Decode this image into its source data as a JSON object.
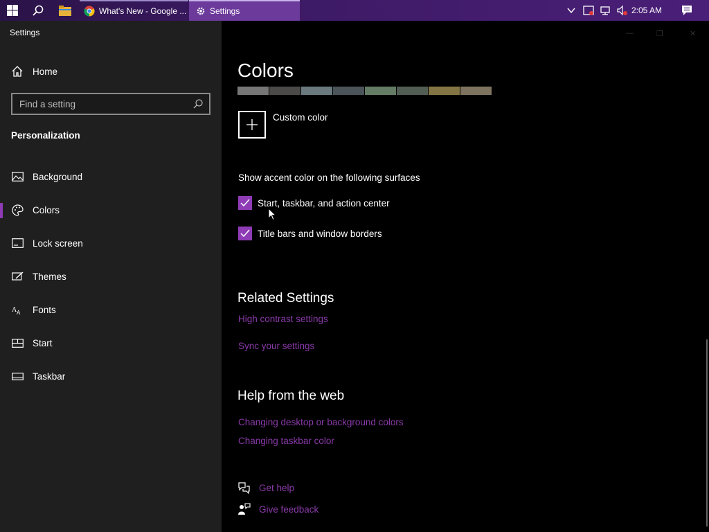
{
  "taskbar": {
    "apps": [
      {
        "label": "What's New - Google ..."
      },
      {
        "label": "Settings"
      }
    ],
    "clock": "2:05 AM"
  },
  "sidebar": {
    "app_title": "Settings",
    "home": "Home",
    "search_placeholder": "Find a setting",
    "section": "Personalization",
    "items": [
      {
        "label": "Background",
        "icon": "picture-icon"
      },
      {
        "label": "Colors",
        "icon": "palette-icon",
        "active": true
      },
      {
        "label": "Lock screen",
        "icon": "lock-screen-icon"
      },
      {
        "label": "Themes",
        "icon": "themes-icon"
      },
      {
        "label": "Fonts",
        "icon": "fonts-icon"
      },
      {
        "label": "Start",
        "icon": "start-icon"
      },
      {
        "label": "Taskbar",
        "icon": "taskbar-icon"
      }
    ]
  },
  "main": {
    "title": "Colors",
    "swatches": [
      "#7a7a7a",
      "#4c4a48",
      "#68768a",
      "#515c6b",
      "#567c73",
      "#486860",
      "#7e735f",
      "#7e735f"
    ],
    "swatch_colors": [
      "#767676",
      "#4c4a48",
      "#69797e",
      "#4a5459",
      "#647c64",
      "#525e54",
      "#847545",
      "#7e735f"
    ],
    "custom_color": "Custom color",
    "surfaces_title": "Show accent color on the following surfaces",
    "checkboxes": [
      {
        "label": "Start, taskbar, and action center",
        "checked": true
      },
      {
        "label": "Title bars and window borders",
        "checked": true
      }
    ],
    "related_title": "Related Settings",
    "related_links": [
      "High contrast settings",
      "Sync your settings"
    ],
    "help_title": "Help from the web",
    "help_links": [
      "Changing desktop or background colors",
      "Changing taskbar color"
    ],
    "get_help": "Get help",
    "give_feedback": "Give feedback"
  },
  "colors": {
    "accent": "#8e3bb5",
    "link": "#8a3aa9",
    "sidebar_bg": "#1f1f1f"
  }
}
